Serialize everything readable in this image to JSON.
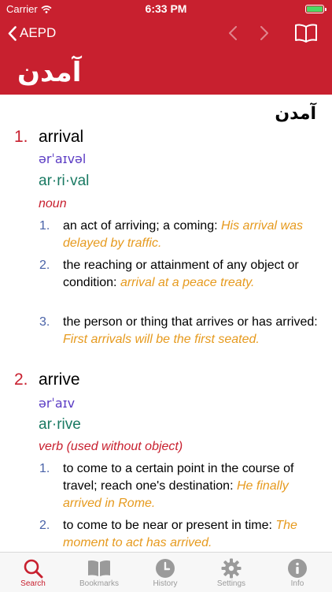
{
  "status_bar": {
    "carrier": "Carrier",
    "time": "6:33 PM"
  },
  "nav": {
    "back_label": "AEPD"
  },
  "hero_word": "آمدن",
  "entry_word": "آمدن",
  "definitions": [
    {
      "number": "1.",
      "word": "arrival",
      "ipa": "ərˈaɪvəl",
      "syllables": "ar·ri·val",
      "pos": "noun",
      "senses": [
        {
          "number": "1.",
          "text": "an act of arriving; a coming: ",
          "example": "His arrival was delayed by traffic."
        },
        {
          "number": "2.",
          "text": "the reaching or attainment of any object or condition: ",
          "example": "arrival at a peace treaty."
        },
        {
          "number": "3.",
          "text": "the person or thing that arrives or has arrived: ",
          "example": "First arrivals will be the first seated."
        }
      ]
    },
    {
      "number": "2.",
      "word": "arrive",
      "ipa": "ərˈaɪv",
      "syllables": "ar·rive",
      "pos": "verb (used without object)",
      "senses": [
        {
          "number": "1.",
          "text": "to come to a certain point in the course of travel; reach one's destination: ",
          "example": "He finally arrived in Rome."
        },
        {
          "number": "2.",
          "text": "to come to be near or present in time: ",
          "example": "The moment to act has arrived."
        }
      ]
    }
  ],
  "tabs": [
    {
      "label": "Search",
      "icon": "search-icon",
      "active": true
    },
    {
      "label": "Bookmarks",
      "icon": "book-icon",
      "active": false
    },
    {
      "label": "History",
      "icon": "clock-icon",
      "active": false
    },
    {
      "label": "Settings",
      "icon": "gear-icon",
      "active": false
    },
    {
      "label": "Info",
      "icon": "info-icon",
      "active": false
    }
  ],
  "colors": {
    "brand": "#c8202f",
    "ipa": "#5b3cc4",
    "syllables": "#1a7a63",
    "example": "#e69a1e",
    "sense_number": "#4a63a8"
  }
}
